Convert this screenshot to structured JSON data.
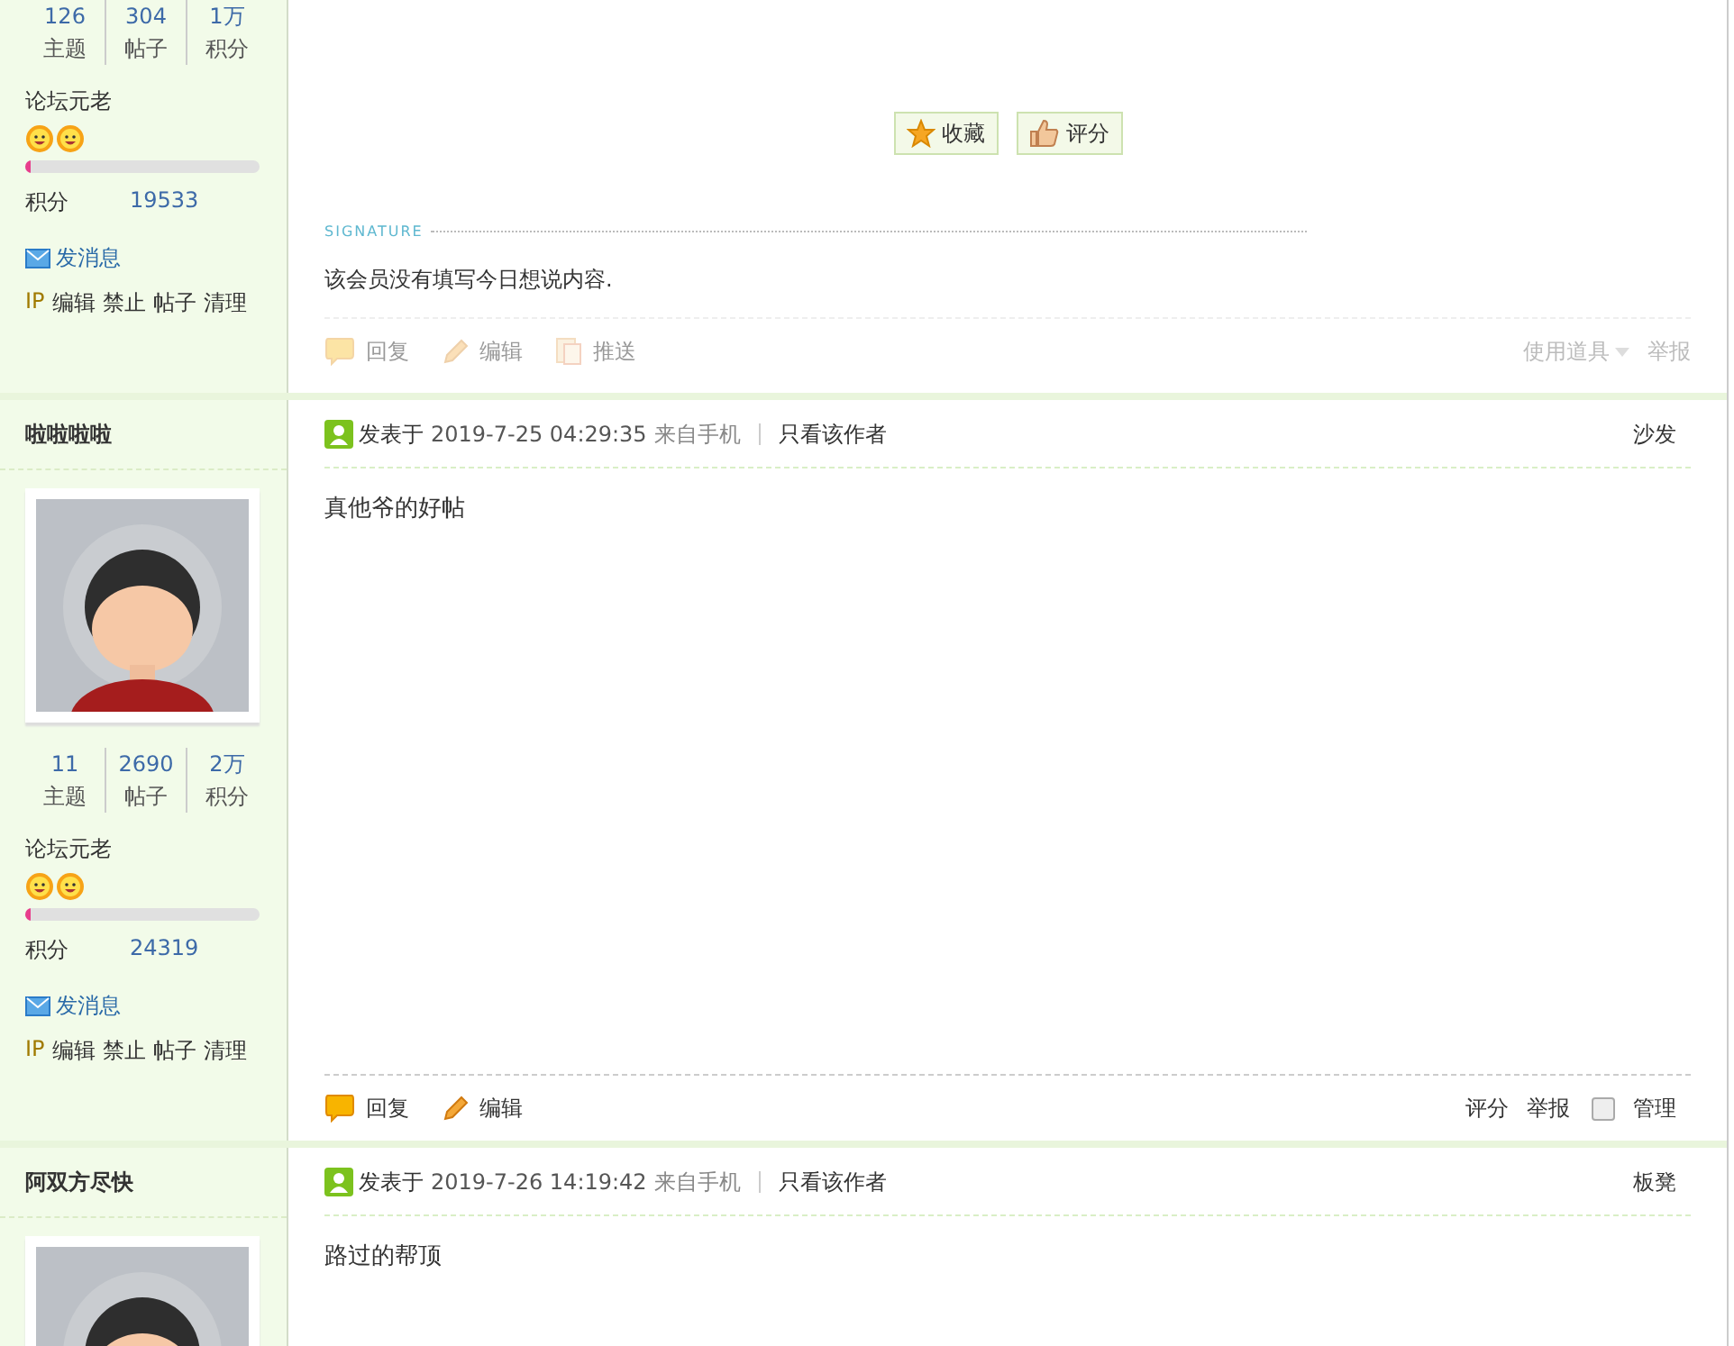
{
  "posts": [
    {
      "stats": [
        {
          "value": "126",
          "label": "主题"
        },
        {
          "value": "304",
          "label": "帖子"
        },
        {
          "value": "1万",
          "label": "积分"
        }
      ],
      "rank": "论坛元老",
      "rank_icons": [
        {
          "kind": "smiley"
        },
        {
          "kind": "smiley"
        }
      ],
      "level": 0.02,
      "points_label": "积分",
      "points": "19533",
      "message_link": "发消息",
      "admin_links": [
        "IP",
        "编辑",
        "禁止",
        "帖子",
        "清理"
      ],
      "post_buttons": [
        {
          "kind": "star",
          "label": "收藏"
        },
        {
          "kind": "thumb",
          "label": "评分"
        }
      ],
      "signature": {
        "label": "SIGNATURE",
        "text": "该会员没有填写今日想说内容."
      },
      "actions_left": [
        {
          "kind": "reply",
          "label": "回复",
          "disabled": true
        },
        {
          "kind": "edit",
          "label": "编辑",
          "disabled": true
        },
        {
          "kind": "push",
          "label": "推送",
          "disabled": true
        }
      ],
      "actions_right": [
        {
          "kind": "menu",
          "label": "使用道具",
          "disabled": true
        },
        {
          "kind": "link",
          "label": "举报",
          "disabled": true
        }
      ]
    },
    {
      "author": "啦啦啦啦",
      "stats": [
        {
          "value": "11",
          "label": "主题"
        },
        {
          "value": "2690",
          "label": "帖子"
        },
        {
          "value": "2万",
          "label": "积分"
        }
      ],
      "rank": "论坛元老",
      "rank_icons": [
        {
          "kind": "smiley"
        },
        {
          "kind": "smiley"
        }
      ],
      "level": 0.02,
      "points_label": "积分",
      "points": "24319",
      "message_link": "发消息",
      "admin_links": [
        "IP",
        "编辑",
        "禁止",
        "帖子",
        "清理"
      ],
      "header": {
        "posted_label": "发表于",
        "time": "2019-7-25 04:29:35",
        "source": "来自手机",
        "author_only": "只看该作者",
        "floor": "沙发"
      },
      "content": "真他爷的好帖",
      "actions_left": [
        {
          "kind": "reply",
          "label": "回复",
          "disabled": false
        },
        {
          "kind": "edit",
          "label": "编辑",
          "disabled": false
        }
      ],
      "actions_right": [
        {
          "kind": "link",
          "label": "评分",
          "disabled": false
        },
        {
          "kind": "link",
          "label": "举报",
          "disabled": false
        },
        {
          "kind": "checkbox",
          "label": "管理",
          "checked": false,
          "disabled": false
        }
      ]
    },
    {
      "author": "阿双方尽快",
      "header": {
        "posted_label": "发表于",
        "time": "2019-7-26 14:19:42",
        "source": "来自手机",
        "author_only": "只看该作者",
        "floor": "板凳"
      },
      "content": "路过的帮顶"
    }
  ]
}
